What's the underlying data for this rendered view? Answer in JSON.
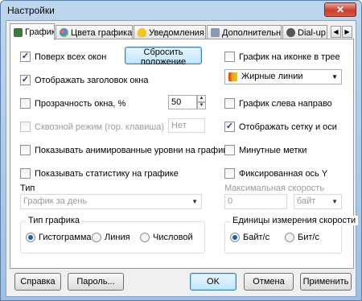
{
  "window": {
    "title": "Настройки",
    "close_glyph": "✕"
  },
  "tabs": [
    {
      "label": "График",
      "icon": "chart-icon",
      "color": "#3a7a3a"
    },
    {
      "label": "Цвета графика",
      "icon": "palette-icon",
      "color": "#4a8ad8"
    },
    {
      "label": "Уведомления",
      "icon": "lightbulb-icon",
      "color": "#f2c81e"
    },
    {
      "label": "Дополнительные",
      "icon": "settings-icon",
      "color": "#8a9ab0"
    },
    {
      "label": "Dial-up",
      "icon": "modem-icon",
      "color": "#555555"
    }
  ],
  "tab_scroll": {
    "left": "◀",
    "right": "▶"
  },
  "left": {
    "always_on_top": {
      "label": "Поверх всех окон",
      "checked": true
    },
    "reset_position": "Сбросить положение",
    "show_title": {
      "label": "Отображать заголовок окна",
      "checked": true
    },
    "opacity": {
      "label": "Прозрачность окна, %",
      "checked": false,
      "value": "50"
    },
    "passthrough": {
      "label": "Сквозной режим (гор. клавиша)",
      "checked": false,
      "hotkey": "Нет"
    },
    "animated_levels": {
      "label": "Показывать анимированные уровни на графике",
      "checked": false
    },
    "show_stats": {
      "label": "Показывать статистику на графике",
      "checked": false
    },
    "type_label": "Тип",
    "type_value": "График за день",
    "graph_type": {
      "title": "Тип графика",
      "options": [
        "Гистограмма",
        "Линия",
        "Числовой"
      ],
      "selected": "Гистограмма"
    }
  },
  "right": {
    "tray_chart": {
      "label": "График на иконке в трее",
      "checked": false
    },
    "line_style": "Жирные линии",
    "left_to_right": {
      "label": "График слева направо",
      "checked": false
    },
    "grid_axes": {
      "label": "Отображать сетку и оси",
      "checked": true
    },
    "minute_marks": {
      "label": "Минутные метки",
      "checked": false
    },
    "fixed_y": {
      "label": "Фиксированная ось Y",
      "checked": false
    },
    "max_speed_label": "Максимальная скорость",
    "max_speed_value": "0",
    "max_speed_unit": "байт",
    "speed_units": {
      "title": "Единицы измерения скорости",
      "options": [
        "Байт/с",
        "Бит/с"
      ],
      "selected": "Байт/с"
    }
  },
  "footer": {
    "help": "Справка",
    "password": "Пароль...",
    "ok": "OK",
    "cancel": "Отмена",
    "apply": "Применить"
  }
}
